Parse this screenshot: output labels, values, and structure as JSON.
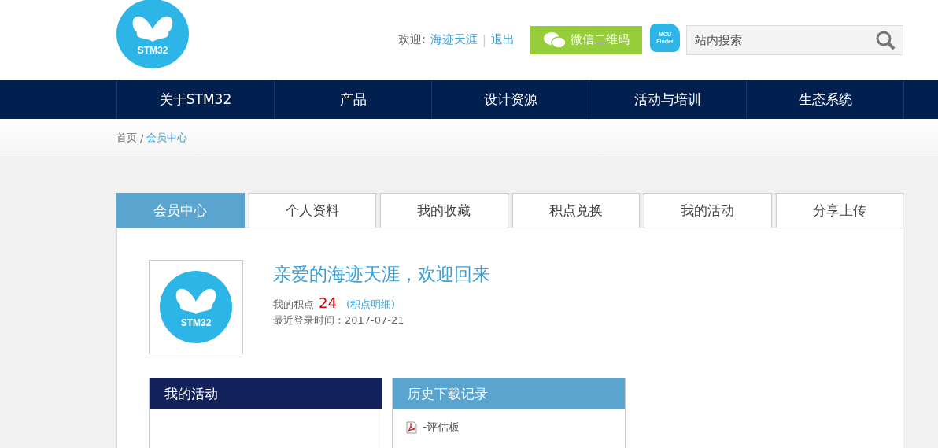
{
  "header": {
    "logo_text": "STM32",
    "welcome_label": "欢迎:",
    "username": "海迹天涯",
    "separator": "|",
    "logout": "退出",
    "wechat_button": "微信二维码",
    "finder_badge": [
      "MCU",
      "Finder"
    ],
    "search": {
      "placeholder": "站内搜索"
    }
  },
  "nav": [
    "关于STM32",
    "产品",
    "设计资源",
    "活动与培训",
    "生态系统"
  ],
  "breadcrumb": [
    "首页",
    "会员中心"
  ],
  "breadcrumb_separator": "/",
  "tabs": [
    {
      "label": "会员中心",
      "selected": true
    },
    {
      "label": "个人资料",
      "selected": false
    },
    {
      "label": "我的收藏",
      "selected": false
    },
    {
      "label": "积点兑换",
      "selected": false
    },
    {
      "label": "我的活动",
      "selected": false
    },
    {
      "label": "分享上传",
      "selected": false
    }
  ],
  "profile": {
    "avatar_text": "STM32",
    "greeting": "亲爱的海迹天涯，欢迎回来",
    "points_label": "我的积点",
    "points": "24",
    "points_link": "(积点明细)",
    "last_login": "最近登录时间：2017-07-21"
  },
  "boxes": [
    {
      "title": "我的活动",
      "kind": "dark"
    },
    {
      "title": "历史下载记录",
      "kind": "light",
      "items": [
        "-评估板"
      ]
    }
  ]
}
